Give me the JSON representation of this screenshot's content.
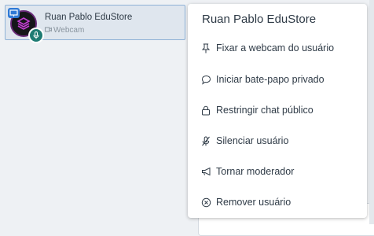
{
  "user": {
    "name": "Ruan Pablo EduStore",
    "status": "Webcam"
  },
  "menu": {
    "title": "Ruan Pablo EduStore",
    "items": [
      {
        "label": "Fixar a webcam do usuário",
        "icon": "pin-icon"
      },
      {
        "label": "Iniciar bate-papo privado",
        "icon": "chat-bubble-icon"
      },
      {
        "label": "Restringir chat público",
        "icon": "lock-icon"
      },
      {
        "label": "Silenciar usuário",
        "icon": "mic-off-icon"
      },
      {
        "label": "Tornar moderador",
        "icon": "megaphone-icon"
      },
      {
        "label": "Remover usuário",
        "icon": "remove-circle-icon"
      }
    ]
  },
  "colors": {
    "accent": "#2f7ad6",
    "moderator_badge": "#1e7b73",
    "card_bg": "#dfe6ee"
  }
}
